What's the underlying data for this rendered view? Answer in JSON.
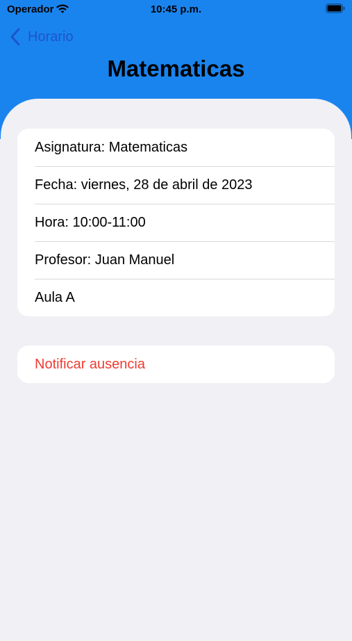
{
  "status_bar": {
    "carrier": "Operador",
    "time": "10:45 p.m."
  },
  "nav": {
    "back_label": "Horario",
    "title": "Matematicas"
  },
  "details": [
    "Asignatura: Matematicas",
    "Fecha: viernes, 28 de abril de 2023",
    "Hora: 10:00-11:00",
    "Profesor: Juan Manuel",
    "Aula A"
  ],
  "actions": {
    "notify_absence": "Notificar ausencia"
  },
  "colors": {
    "header_background": "#1a84ee",
    "back_tint": "#1d55c9",
    "page_background": "#f0f0f5",
    "destructive": "#ef3b30"
  },
  "icons": {
    "wifi": "wifi-icon",
    "battery": "battery-icon",
    "back": "chevron-left-icon"
  }
}
